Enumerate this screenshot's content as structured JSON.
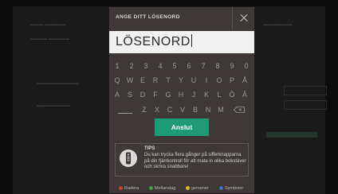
{
  "dialog": {
    "title": "ANGE DITT LÖSENORD",
    "password_value": "LÖSENORD",
    "connect_label": "Anslut"
  },
  "keyboard": {
    "row1": [
      "1",
      "2",
      "3",
      "4",
      "5",
      "6",
      "7",
      "8",
      "9",
      "0"
    ],
    "row2": [
      "Q",
      "W",
      "E",
      "R",
      "T",
      "Y",
      "U",
      "I",
      "O",
      "P",
      "Å"
    ],
    "row3": [
      "A",
      "S",
      "D",
      "F",
      "G",
      "H",
      "J",
      "K",
      "L",
      "Ö",
      "Ä"
    ],
    "row4": [
      "Z",
      "X",
      "C",
      "V",
      "B",
      "N",
      "M"
    ],
    "icons": {
      "space": "space-icon",
      "backspace": "backspace-icon"
    }
  },
  "tips": {
    "title": "TIPS",
    "text": "Du kan trycka flera gånger på sifferknapparna på din fjärrkontroll för att mata in olika bokstäver och skriva snabbare!",
    "icon": "remote-control-icon"
  },
  "legend": [
    {
      "label": "Radera",
      "color": "#c8402a"
    },
    {
      "label": "Mellanslag",
      "color": "#3f9d3a"
    },
    {
      "label": "gemener",
      "color": "#d8b23a"
    },
    {
      "label": "Symboler",
      "color": "#3a72c8"
    }
  ]
}
